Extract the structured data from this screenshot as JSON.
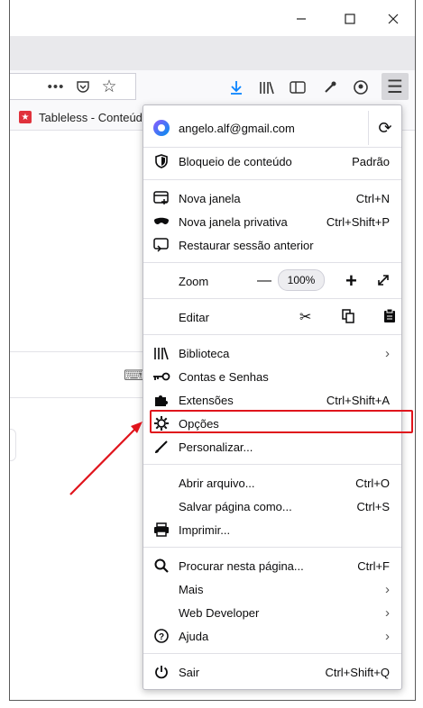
{
  "window": {
    "minimize_icon": "minimize-icon",
    "maximize_icon": "maximize-icon",
    "close_icon": "close-icon"
  },
  "bookmarks": {
    "items": [
      {
        "label": "Tableless - Conteúdo",
        "icon": "star-favicon-icon",
        "color": "#e0323c"
      }
    ]
  },
  "menu": {
    "account": {
      "email": "angelo.alf@gmail.com"
    },
    "content_blocking": {
      "label": "Bloqueio de conteúdo",
      "value": "Padrão"
    },
    "new_window": {
      "label": "Nova janela",
      "shortcut": "Ctrl+N"
    },
    "private_window": {
      "label": "Nova janela privativa",
      "shortcut": "Ctrl+Shift+P"
    },
    "restore_session": {
      "label": "Restaurar sessão anterior"
    },
    "zoom": {
      "label": "Zoom",
      "minus": "—",
      "level": "100%",
      "plus": "+"
    },
    "edit": {
      "label": "Editar"
    },
    "library": {
      "label": "Biblioteca"
    },
    "logins": {
      "label": "Contas e Senhas"
    },
    "addons": {
      "label": "Extensões",
      "shortcut": "Ctrl+Shift+A"
    },
    "options": {
      "label": "Opções"
    },
    "customize": {
      "label": "Personalizar..."
    },
    "open_file": {
      "label": "Abrir arquivo...",
      "shortcut": "Ctrl+O"
    },
    "save_page": {
      "label": "Salvar página como...",
      "shortcut": "Ctrl+S"
    },
    "print": {
      "label": "Imprimir..."
    },
    "find": {
      "label": "Procurar nesta página...",
      "shortcut": "Ctrl+F"
    },
    "more": {
      "label": "Mais"
    },
    "web_dev": {
      "label": "Web Developer"
    },
    "help": {
      "label": "Ajuda"
    },
    "quit": {
      "label": "Sair",
      "shortcut": "Ctrl+Shift+Q"
    }
  },
  "annotation": {
    "highlight_color": "#e0141c",
    "arrow_color": "#e0141c"
  }
}
